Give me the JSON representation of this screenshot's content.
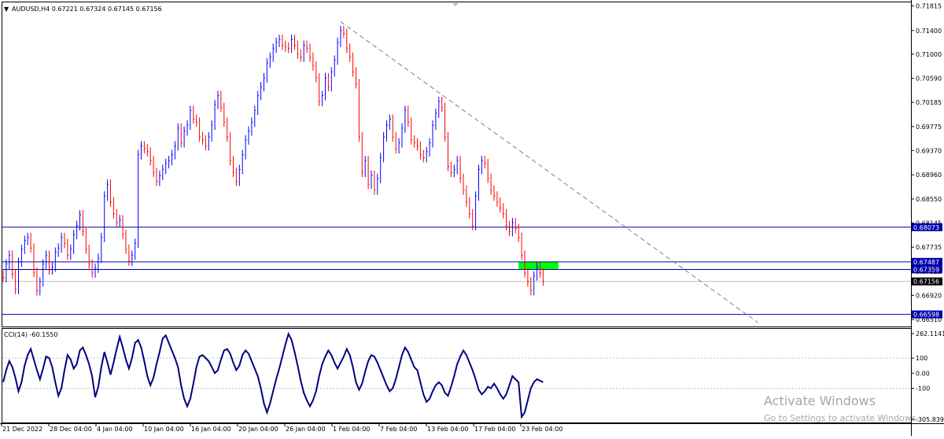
{
  "header": {
    "symbol_line": "AUDUSD,H4  0.67221 0.67324 0.67145 0.67156",
    "menu_glyph": "▼"
  },
  "indicator": {
    "label": "CCI(14) -60.1550",
    "axis_labels": [
      "262.1141",
      "100",
      "0.00",
      "-100",
      "-305.839"
    ]
  },
  "watermark": {
    "title": "Activate Windows",
    "subtitle": "Go to Settings to activate Windows."
  },
  "colors": {
    "bull": "#0000ff",
    "bear": "#ff0000",
    "level_line": "#0000aa",
    "zone": "#00ff00",
    "cci_line": "#000080",
    "trend_line": "#808080",
    "price_tag": "#000000"
  },
  "chart_data": [
    {
      "type": "candlestick",
      "title": "AUDUSD,H4",
      "ohlc_header": {
        "open": 0.67221,
        "high": 0.67324,
        "low": 0.67145,
        "close": 0.67156
      },
      "x_labels": [
        "21 Dec 2022",
        "28 Dec 04:00",
        "4 Jan 04:00",
        "10 Jan 04:00",
        "16 Jan 04:00",
        "20 Jan 04:00",
        "26 Jan 04:00",
        "1 Feb 04:00",
        "7 Feb 04:00",
        "13 Feb 04:00",
        "17 Feb 04:00",
        "23 Feb 04:00"
      ],
      "y_ticks": [
        0.71815,
        0.714,
        0.71,
        0.7059,
        0.70185,
        0.69775,
        0.6937,
        0.6896,
        0.6855,
        0.68145,
        0.67735,
        0.67325,
        0.6692,
        0.6651
      ],
      "ylim": [
        0.6646,
        0.7185
      ],
      "horizontal_levels": [
        0.68073,
        0.67487,
        0.67359,
        0.66598
      ],
      "current_price": 0.67156,
      "supply_zone": {
        "low": 0.67359,
        "high": 0.67487,
        "from_bar": 168,
        "to_bar": 181
      },
      "trend_line": {
        "from": {
          "bar": 110,
          "price": 0.7155
        },
        "to": {
          "bar": 246,
          "price": 0.6646
        }
      },
      "closes": [
        0.6722,
        0.6745,
        0.676,
        0.6728,
        0.6702,
        0.6748,
        0.677,
        0.6785,
        0.679,
        0.6772,
        0.6731,
        0.67,
        0.6715,
        0.6745,
        0.676,
        0.6735,
        0.674,
        0.6765,
        0.6772,
        0.679,
        0.678,
        0.676,
        0.677,
        0.6795,
        0.681,
        0.6828,
        0.68,
        0.677,
        0.6745,
        0.673,
        0.6738,
        0.6755,
        0.679,
        0.686,
        0.688,
        0.685,
        0.683,
        0.6815,
        0.682,
        0.6795,
        0.677,
        0.675,
        0.676,
        0.678,
        0.693,
        0.6945,
        0.694,
        0.6935,
        0.692,
        0.69,
        0.6885,
        0.6895,
        0.6905,
        0.6915,
        0.692,
        0.693,
        0.6945,
        0.6975,
        0.695,
        0.697,
        0.698,
        0.7005,
        0.699,
        0.6985,
        0.696,
        0.6955,
        0.6945,
        0.696,
        0.698,
        0.7015,
        0.703,
        0.701,
        0.6985,
        0.696,
        0.692,
        0.69,
        0.6885,
        0.6905,
        0.693,
        0.6955,
        0.697,
        0.6985,
        0.7005,
        0.703,
        0.7045,
        0.706,
        0.7085,
        0.7095,
        0.711,
        0.712,
        0.7125,
        0.7115,
        0.7112,
        0.711,
        0.7125,
        0.7115,
        0.71,
        0.7095,
        0.7115,
        0.711,
        0.7095,
        0.708,
        0.706,
        0.702,
        0.703,
        0.706,
        0.7045,
        0.707,
        0.709,
        0.712,
        0.714,
        0.7135,
        0.711,
        0.7095,
        0.707,
        0.705,
        0.696,
        0.69,
        0.692,
        0.688,
        0.6895,
        0.687,
        0.689,
        0.6925,
        0.696,
        0.698,
        0.699,
        0.696,
        0.694,
        0.695,
        0.6975,
        0.7005,
        0.6985,
        0.6955,
        0.695,
        0.6945,
        0.693,
        0.6925,
        0.6935,
        0.695,
        0.698,
        0.7,
        0.702,
        0.701,
        0.696,
        0.691,
        0.69,
        0.6905,
        0.692,
        0.689,
        0.687,
        0.685,
        0.683,
        0.681,
        0.686,
        0.6905,
        0.692,
        0.6915,
        0.689,
        0.687,
        0.686,
        0.685,
        0.684,
        0.683,
        0.681,
        0.68,
        0.6815,
        0.6805,
        0.679,
        0.676,
        0.673,
        0.6715,
        0.67,
        0.6725,
        0.674,
        0.673,
        0.6716
      ]
    },
    {
      "type": "line",
      "title": "CCI(14) -60.1550",
      "ylim": [
        -305.839,
        262.1141
      ],
      "y_ticks": [
        262.1141,
        100,
        0,
        -100,
        -305.839
      ],
      "series": [
        {
          "name": "CCI(14)",
          "values": [
            -60,
            20,
            80,
            40,
            -30,
            -120,
            -60,
            50,
            120,
            160,
            90,
            20,
            -40,
            30,
            110,
            100,
            40,
            -60,
            -150,
            -100,
            20,
            120,
            90,
            30,
            60,
            150,
            170,
            120,
            60,
            -20,
            -160,
            -90,
            40,
            140,
            70,
            -10,
            70,
            160,
            240,
            170,
            90,
            30,
            100,
            200,
            220,
            170,
            80,
            -20,
            -80,
            -30,
            60,
            140,
            230,
            250,
            200,
            150,
            100,
            40,
            -80,
            -170,
            -220,
            -170,
            -70,
            40,
            110,
            120,
            100,
            80,
            40,
            0,
            20,
            90,
            150,
            160,
            130,
            70,
            20,
            50,
            120,
            150,
            130,
            80,
            30,
            -20,
            -100,
            -200,
            -260,
            -200,
            -120,
            -40,
            30,
            110,
            190,
            260,
            220,
            140,
            50,
            -50,
            -130,
            -180,
            -220,
            -180,
            -120,
            -20,
            60,
            110,
            150,
            120,
            70,
            30,
            70,
            110,
            160,
            120,
            40,
            -60,
            -110,
            -70,
            10,
            80,
            120,
            110,
            70,
            20,
            -30,
            -80,
            -120,
            -100,
            -40,
            40,
            120,
            170,
            140,
            90,
            40,
            20,
            -60,
            -140,
            -190,
            -170,
            -120,
            -80,
            -60,
            -80,
            -130,
            -150,
            -90,
            -20,
            60,
            110,
            150,
            120,
            70,
            20,
            -40,
            -110,
            -140,
            -120,
            -90,
            -100,
            -70,
            -100,
            -140,
            -170,
            -140,
            -80,
            -20,
            -40,
            -60,
            -290,
            -260,
            -180,
            -100,
            -60,
            -40,
            -50,
            -60
          ]
        }
      ]
    }
  ]
}
